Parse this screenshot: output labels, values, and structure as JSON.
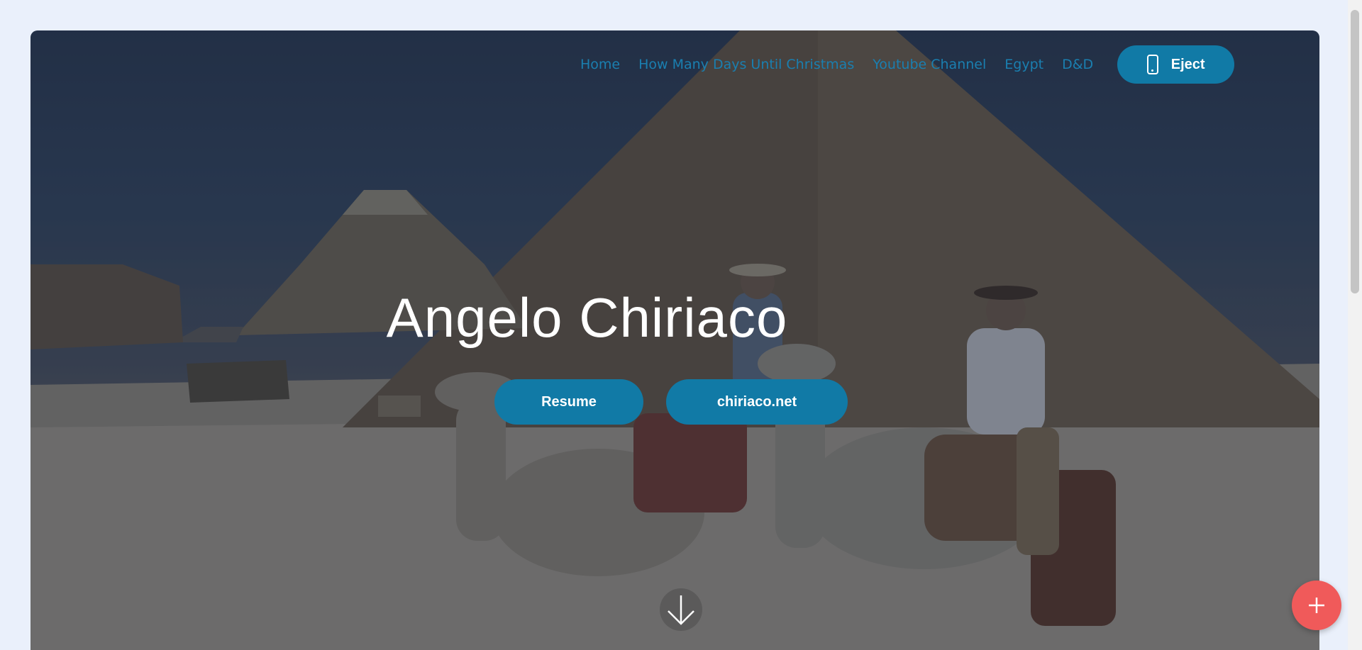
{
  "nav": {
    "items": [
      {
        "label": "Home"
      },
      {
        "label": "How Many Days Until Christmas"
      },
      {
        "label": "Youtube Channel"
      },
      {
        "label": "Egypt"
      },
      {
        "label": "D&D"
      }
    ],
    "eject_label": "Eject",
    "eject_icon": "phone-icon"
  },
  "hero": {
    "title": "Angelo Chiriaco",
    "buttons": {
      "resume_label": "Resume",
      "site_label": "chiriaco.net"
    },
    "scroll_icon": "arrow-down-icon"
  },
  "fab": {
    "icon": "plus-icon"
  },
  "colors": {
    "accent": "#117aa6",
    "nav_link": "#1a7fb0",
    "fab": "#f05a5a",
    "page_bg": "#eaf0fb"
  }
}
